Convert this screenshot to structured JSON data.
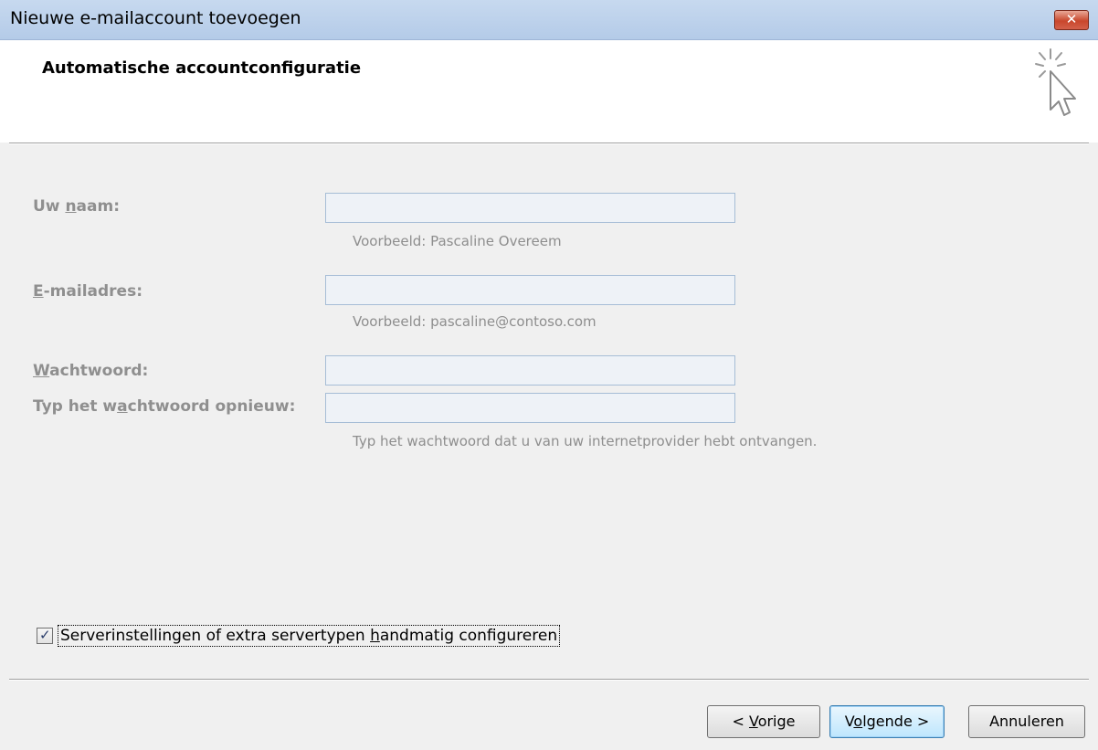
{
  "window": {
    "title": "Nieuwe e-mailaccount toevoegen",
    "close_glyph": "✕"
  },
  "header": {
    "title": "Automatische accountconfiguratie",
    "icon": "auto-config-cursor-icon"
  },
  "form": {
    "name": {
      "label_pre": "Uw ",
      "label_accel": "n",
      "label_post": "aam:",
      "value": "",
      "hint": "Voorbeeld: Pascaline Overeem"
    },
    "email": {
      "label_pre": "",
      "label_accel": "E",
      "label_post": "-mailadres:",
      "value": "",
      "hint": "Voorbeeld: pascaline@contoso.com"
    },
    "password": {
      "label_pre": "",
      "label_accel": "W",
      "label_post": "achtwoord:",
      "value": ""
    },
    "password_repeat": {
      "label_pre": "Typ het w",
      "label_accel": "a",
      "label_post": "chtwoord opnieuw:",
      "value": "",
      "hint": "Typ het wachtwoord dat u van uw internetprovider hebt ontvangen."
    }
  },
  "manual_config": {
    "checked": true,
    "check_glyph": "✓",
    "label_pre": "Serverinstellingen of extra servertypen ",
    "label_accel": "h",
    "label_post": "andmatig configureren"
  },
  "buttons": {
    "back": {
      "pre": "< ",
      "accel": "V",
      "post": "orige"
    },
    "next": {
      "pre": "V",
      "accel": "o",
      "post": "lgende >"
    },
    "cancel": {
      "label": "Annuleren"
    }
  }
}
